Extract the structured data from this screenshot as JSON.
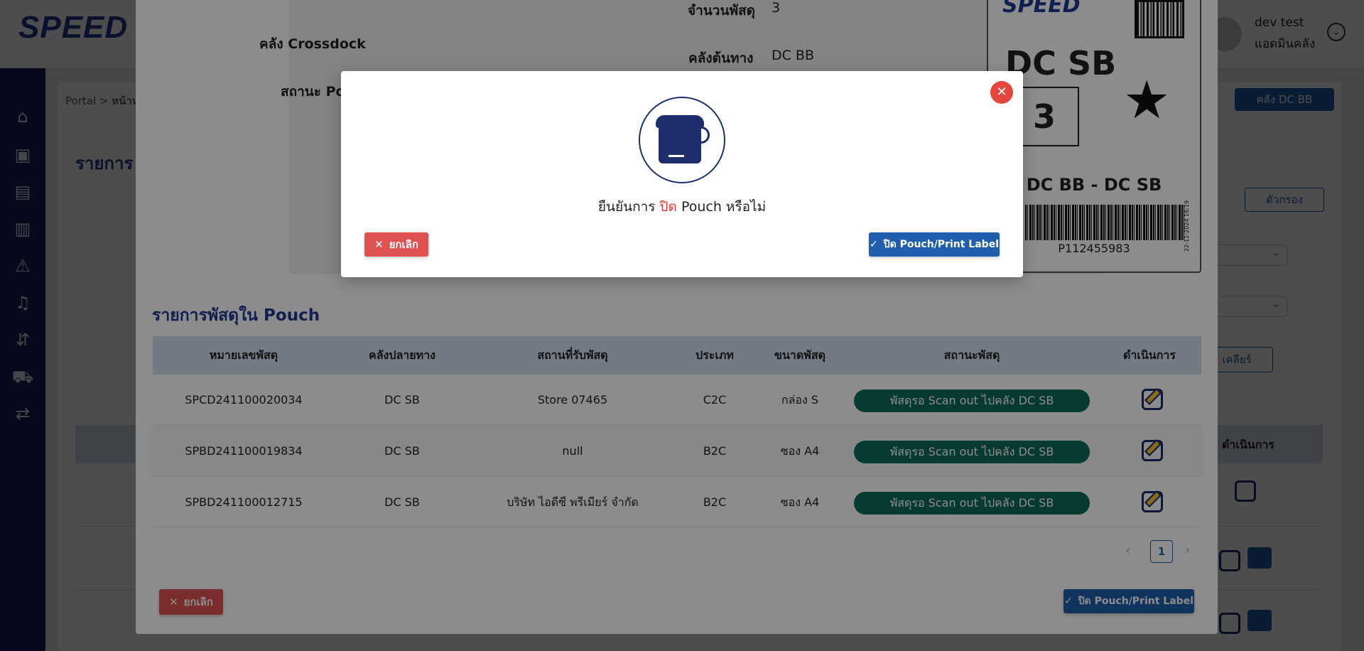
{
  "brand": {
    "logo_main": "SPEED",
    "logo_tail": ""
  },
  "user": {
    "name": "dev test",
    "role": "แอดมินคลัง"
  },
  "breadcrumb": {
    "root": "Portal",
    "current": "หน้าห"
  },
  "page": {
    "heading": "รายการ I",
    "warehouse_button": "คลัง DC BB",
    "filter_button": "ตัวกรอง",
    "clear_button": "เคลียร์",
    "table_action_header": "ดำเนินการ"
  },
  "pouch_modal": {
    "info": {
      "crossdock_label": "คลัง Crossdock",
      "pouch_status_label": "สถานะ Pouch",
      "parcel_count_label": "จำนวนพัสดุ",
      "parcel_count_value": "3",
      "origin_label": "คลังต้นทาง",
      "origin_value": "DC BB"
    },
    "label_card": {
      "logo": "SPEED",
      "destination": "DC SB",
      "count": "3",
      "star": "★",
      "route": "DC BB - DC SB",
      "barcode_number": "P112455983",
      "barcode_date": "22-11-2024 16:19"
    },
    "list_title": "รายการพัสดุใน Pouch",
    "table": {
      "headers": [
        "หมายเลขพัสดุ",
        "คลังปลายทาง",
        "สถานที่รับพัสดุ",
        "ประเภท",
        "ขนาดพัสดุ",
        "สถานะพัสดุ",
        "ดำเนินการ"
      ],
      "rows": [
        {
          "tracking": "SPCD241100020034",
          "dest": "DC SB",
          "pickup": "Store 07465",
          "type": "C2C",
          "size": "กล่อง S",
          "status": "พัสดุรอ Scan out ไปคลัง DC SB"
        },
        {
          "tracking": "SPBD241100019834",
          "dest": "DC SB",
          "pickup": "null",
          "type": "B2C",
          "size": "ซอง A4",
          "status": "พัสดุรอ Scan out ไปคลัง DC SB"
        },
        {
          "tracking": "SPBD241100012715",
          "dest": "DC SB",
          "pickup": "บริษัท ไอดีซี พรีเมียร์ จำกัด",
          "type": "B2C",
          "size": "ซอง A4",
          "status": "พัสดุรอ Scan out ไปคลัง DC SB"
        }
      ]
    },
    "pagination": {
      "prev": "‹",
      "current": "1",
      "next": "›"
    },
    "cancel_button": "ยกเลิก",
    "confirm_button": "ปิด Pouch/Print Label"
  },
  "confirm_dialog": {
    "close": "✕",
    "message_before": "ยืนยันการ",
    "message_highlight": "ปิด",
    "message_after": "Pouch หรือไม่",
    "cancel_button": "ยกเลิก",
    "confirm_button": "ปิด Pouch/Print Label"
  },
  "colors": {
    "sidebar": "#17245d",
    "primary": "#1f5fad",
    "danger": "#e05252",
    "status_pill": "#0e6b5c",
    "heading": "#1f3a93",
    "table_header": "#d4dff0"
  }
}
